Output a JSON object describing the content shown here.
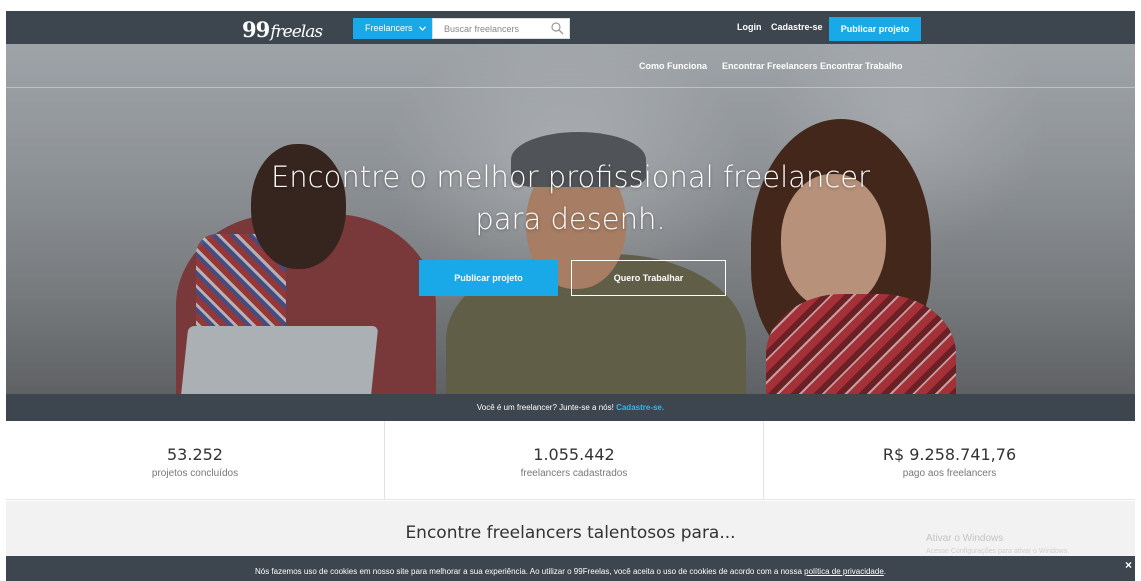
{
  "header": {
    "logo_num": "99",
    "logo_text": "freelas",
    "category_button": "Freelancers",
    "search_placeholder": "Buscar freelancers",
    "login": "Login",
    "signup": "Cadastre-se",
    "publish": "Publicar projeto"
  },
  "subnav": {
    "items": [
      "Como Funciona",
      "Encontrar Freelancers",
      "Encontrar Trabalho"
    ]
  },
  "hero": {
    "headline_line1": "Encontre o melhor profissional freelancer",
    "headline_line2": "para desenh.",
    "primary_button": "Publicar projeto",
    "secondary_button": "Quero Trabalhar"
  },
  "join": {
    "text": "Você é um freelancer? Junte-se a nós!",
    "link": "Cadastre-se."
  },
  "stats": [
    {
      "value": "53.252",
      "label": "projetos concluídos"
    },
    {
      "value": "1.055.442",
      "label": "freelancers cadastrados"
    },
    {
      "value": "R$ 9.258.741,76",
      "label": "pago aos freelancers"
    }
  ],
  "talent": {
    "title": "Encontre freelancers talentosos para..."
  },
  "watermark": {
    "line1": "Ativar o Windows",
    "line2": "Acesse Configurações para ativar o Windows."
  },
  "cookie": {
    "text": "Nós fazemos uso de cookies em nosso site para melhorar a sua experiência. Ao utilizar o 99Freelas, você aceita o uso de cookies de acordo com a nossa",
    "policy_link": "política de privacidade",
    "end": ".",
    "close": "×"
  },
  "colors": {
    "dark_bar": "#3d454f",
    "accent": "#1aa9e8",
    "link": "#34b6f0"
  },
  "icons": [
    "chevron-down-icon",
    "search-icon",
    "close-icon"
  ]
}
